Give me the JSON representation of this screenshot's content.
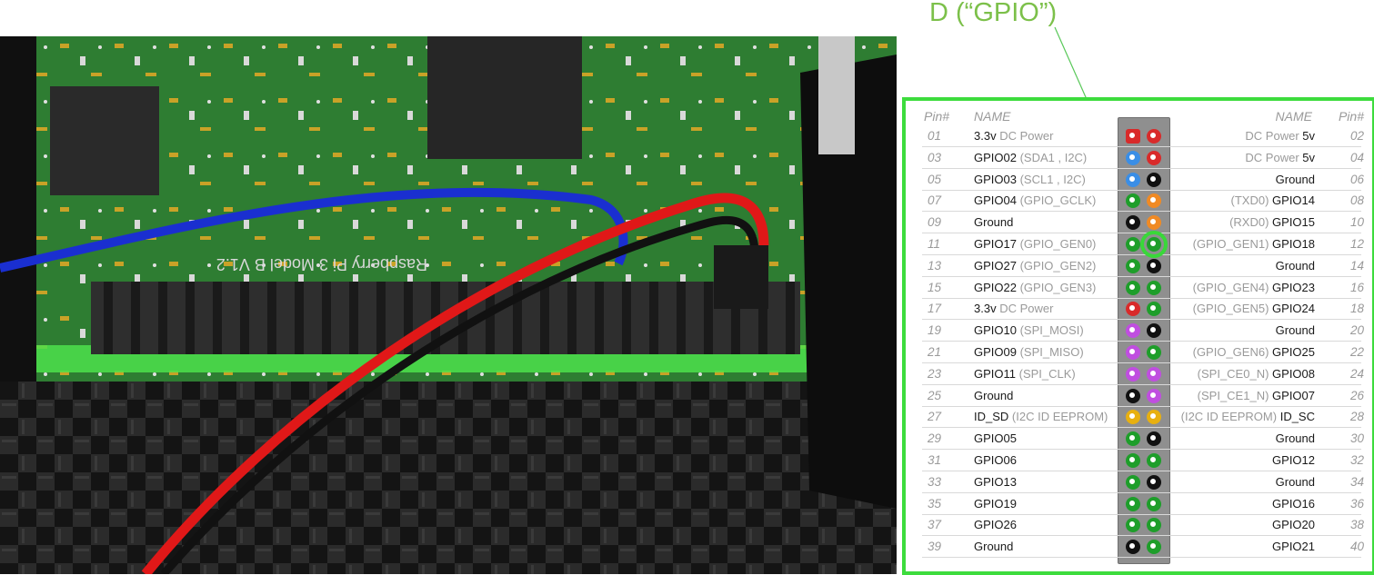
{
  "callout": {
    "label": "D (“GPIO”)"
  },
  "table": {
    "header": {
      "pin_left": "Pin#",
      "name_left": "NAME",
      "name_right": "NAME",
      "pin_right": "Pin#"
    },
    "rows": [
      {
        "pl": "01",
        "lb": "3.3v",
        "lg": " DC Power",
        "cl": "#d92a2a",
        "sql": true,
        "cr": "#d92a2a",
        "rg": "DC Power ",
        "rb": "5v",
        "pr": "02"
      },
      {
        "pl": "03",
        "lb": "GPIO02",
        "lg": " (SDA1 , I2C)",
        "cl": "#3a8ee6",
        "cr": "#d92a2a",
        "rg": "DC Power ",
        "rb": "5v",
        "pr": "04"
      },
      {
        "pl": "05",
        "lb": "GPIO03",
        "lg": " (SCL1 , I2C)",
        "cl": "#3a8ee6",
        "cr": "#111111",
        "rg": "",
        "rb": "Ground",
        "pr": "06"
      },
      {
        "pl": "07",
        "lb": "GPIO04",
        "lg": " (GPIO_GCLK)",
        "cl": "#1e9e2a",
        "cr": "#f08a24",
        "rg": "(TXD0) ",
        "rb": "GPIO14",
        "pr": "08"
      },
      {
        "pl": "09",
        "lb": "Ground",
        "lg": "",
        "cl": "#111111",
        "cr": "#f08a24",
        "rg": "(RXD0) ",
        "rb": "GPIO15",
        "pr": "10"
      },
      {
        "pl": "11",
        "lb": "GPIO17",
        "lg": " (GPIO_GEN0)",
        "cl": "#1e9e2a",
        "cr": "#1e9e2a",
        "rg": "(GPIO_GEN1) ",
        "rb": "GPIO18",
        "pr": "12",
        "hl": true
      },
      {
        "pl": "13",
        "lb": "GPIO27",
        "lg": " (GPIO_GEN2)",
        "cl": "#1e9e2a",
        "cr": "#111111",
        "rg": "",
        "rb": "Ground",
        "pr": "14"
      },
      {
        "pl": "15",
        "lb": "GPIO22",
        "lg": " (GPIO_GEN3)",
        "cl": "#1e9e2a",
        "cr": "#1e9e2a",
        "rg": "(GPIO_GEN4) ",
        "rb": "GPIO23",
        "pr": "16"
      },
      {
        "pl": "17",
        "lb": "3.3v",
        "lg": " DC Power",
        "cl": "#d92a2a",
        "cr": "#1e9e2a",
        "rg": "(GPIO_GEN5) ",
        "rb": "GPIO24",
        "pr": "18"
      },
      {
        "pl": "19",
        "lb": "GPIO10",
        "lg": " (SPI_MOSI)",
        "cl": "#c04ee0",
        "cr": "#111111",
        "rg": "",
        "rb": "Ground",
        "pr": "20"
      },
      {
        "pl": "21",
        "lb": "GPIO09",
        "lg": " (SPI_MISO)",
        "cl": "#c04ee0",
        "cr": "#1e9e2a",
        "rg": "(GPIO_GEN6) ",
        "rb": "GPIO25",
        "pr": "22"
      },
      {
        "pl": "23",
        "lb": "GPIO11",
        "lg": " (SPI_CLK)",
        "cl": "#c04ee0",
        "cr": "#c04ee0",
        "rg": "(SPI_CE0_N) ",
        "rb": "GPIO08",
        "pr": "24"
      },
      {
        "pl": "25",
        "lb": "Ground",
        "lg": "",
        "cl": "#111111",
        "cr": "#c04ee0",
        "rg": "(SPI_CE1_N) ",
        "rb": "GPIO07",
        "pr": "26"
      },
      {
        "pl": "27",
        "lb": "ID_SD",
        "lg": " (I2C ID EEPROM)",
        "cl": "#e8b010",
        "cr": "#e8b010",
        "rg": "(I2C ID EEPROM) ",
        "rb": "ID_SC",
        "pr": "28"
      },
      {
        "pl": "29",
        "lb": "GPIO05",
        "lg": "",
        "cl": "#1e9e2a",
        "cr": "#111111",
        "rg": "",
        "rb": "Ground",
        "pr": "30"
      },
      {
        "pl": "31",
        "lb": "GPIO06",
        "lg": "",
        "cl": "#1e9e2a",
        "cr": "#1e9e2a",
        "rg": "",
        "rb": "GPIO12",
        "pr": "32"
      },
      {
        "pl": "33",
        "lb": "GPIO13",
        "lg": "",
        "cl": "#1e9e2a",
        "cr": "#111111",
        "rg": "",
        "rb": "Ground",
        "pr": "34"
      },
      {
        "pl": "35",
        "lb": "GPIO19",
        "lg": "",
        "cl": "#1e9e2a",
        "cr": "#1e9e2a",
        "rg": "",
        "rb": "GPIO16",
        "pr": "36"
      },
      {
        "pl": "37",
        "lb": "GPIO26",
        "lg": "",
        "cl": "#1e9e2a",
        "cr": "#1e9e2a",
        "rg": "",
        "rb": "GPIO20",
        "pr": "38"
      },
      {
        "pl": "39",
        "lb": "Ground",
        "lg": "",
        "cl": "#111111",
        "cr": "#1e9e2a",
        "rg": "",
        "rb": "GPIO21",
        "pr": "40"
      }
    ]
  },
  "colors": {
    "highlight": "#39d839",
    "callout_text": "#7cc04a",
    "border": "#3ddc3d"
  }
}
